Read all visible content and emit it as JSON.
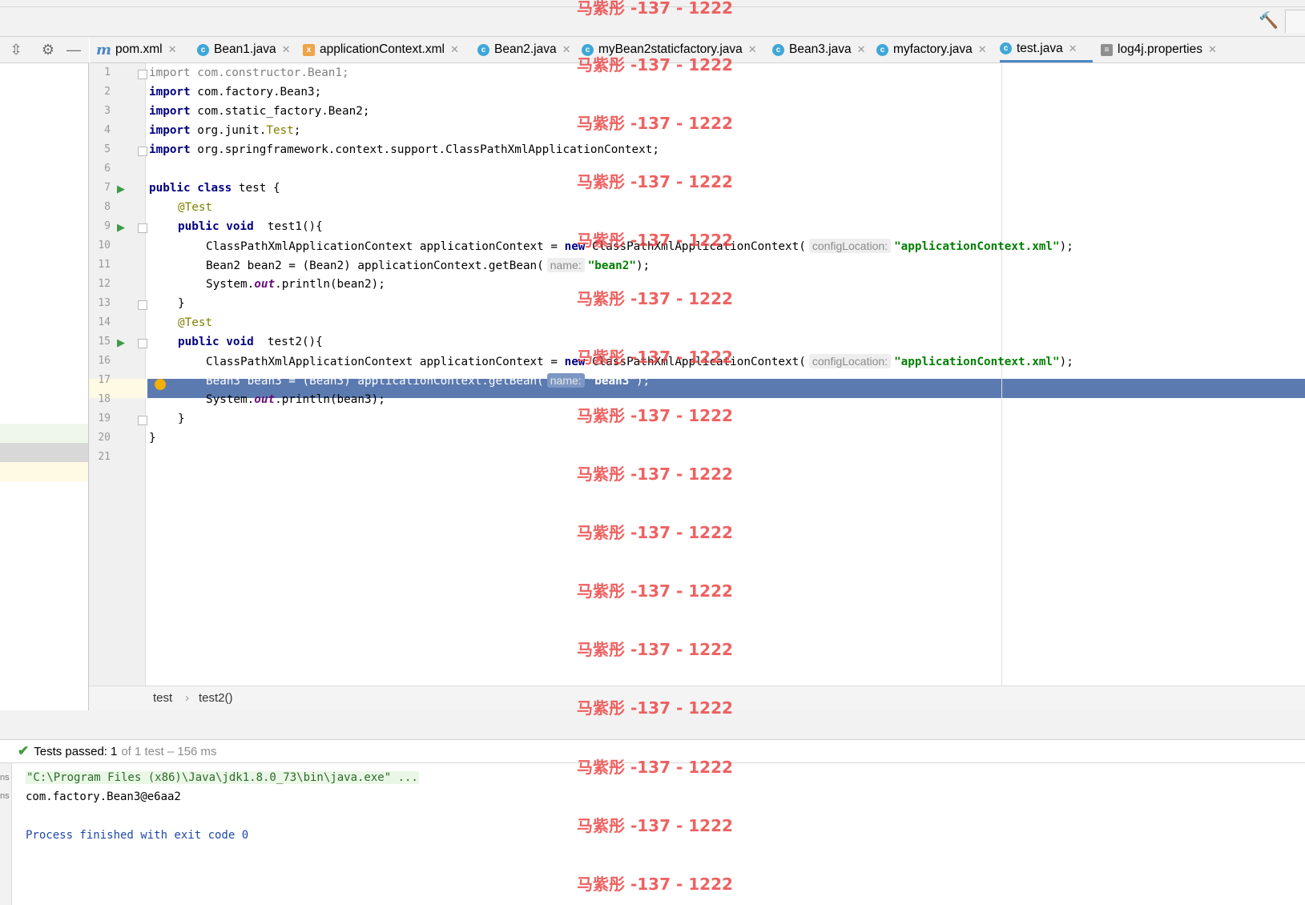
{
  "tabs": [
    {
      "label": "pom.xml",
      "icon": "maven-icon"
    },
    {
      "label": "Bean1.java",
      "icon": "class-icon"
    },
    {
      "label": "applicationContext.xml",
      "icon": "xml-icon"
    },
    {
      "label": "Bean2.java",
      "icon": "class-icon"
    },
    {
      "label": "myBean2staticfactory.java",
      "icon": "class-icon"
    },
    {
      "label": "Bean3.java",
      "icon": "class-icon"
    },
    {
      "label": "myfactory.java",
      "icon": "class-icon"
    },
    {
      "label": "test.java",
      "icon": "class-icon",
      "active": true
    },
    {
      "label": "log4j.properties",
      "icon": "properties-icon"
    }
  ],
  "line_numbers": [
    "1",
    "2",
    "3",
    "4",
    "5",
    "6",
    "7",
    "8",
    "9",
    "10",
    "11",
    "12",
    "13",
    "14",
    "15",
    "16",
    "17",
    "18",
    "19",
    "20",
    "21"
  ],
  "code": {
    "l1_kw": "import",
    "l1_rest": " com.constructor.Bean1;",
    "l2_kw": "import",
    "l2_rest": " com.factory.Bean3;",
    "l3_kw": "import",
    "l3_rest": " com.static_factory.Bean2;",
    "l4_kw": "import",
    "l4_a": " org.junit.",
    "l4_ann": "Test",
    "l4_b": ";",
    "l5_kw": "import",
    "l5_rest": " org.springframework.context.support.ClassPathXmlApplicationContext;",
    "l7_kw": "public class",
    "l7_rest": " test {",
    "l8_ann": "@Test",
    "l9_kw": "public void",
    "l9_rest": "  test1(){",
    "l10_a": "ClassPathXmlApplicationContext applicationContext = ",
    "l10_kw": "new",
    "l10_b": " ClassPathXmlApplicationContext(",
    "l10_hint": "configLocation:",
    "l10_str": "\"applicationContext.xml\"",
    "l10_c": ");",
    "l11_a": "Bean2 bean2 = (Bean2) applicationContext.getBean(",
    "l11_hint": "name:",
    "l11_str": "\"bean2\"",
    "l11_c": ");",
    "l12_a": "System.",
    "l12_fld": "out",
    "l12_b": ".println(bean2);",
    "l13": "}",
    "l14_ann": "@Test",
    "l15_kw": "public void",
    "l15_rest": "  test2(){",
    "l16_a": "ClassPathXmlApplicationContext applicationContext = ",
    "l16_kw": "new",
    "l16_b": " ClassPathXmlApplicationContext(",
    "l16_hint": "configLocation:",
    "l16_str": "\"applicationContext.xml\"",
    "l16_c": ");",
    "l17_a": "Bean3 bean3 = (Bean3) applicationContext.getBean(",
    "l17_hint": "name:",
    "l17_str": "\"bean3\"",
    "l17_c": ");",
    "l18_a": "System.",
    "l18_fld": "out",
    "l18_b": ".println(bean3);",
    "l19": "}",
    "l20": "}"
  },
  "breadcrumb": {
    "class": "test",
    "sep": "›",
    "method": "test2()"
  },
  "test_status": {
    "passed_label": "Tests passed:",
    "count": "1",
    "rest": "of 1 test – 156 ms"
  },
  "console": {
    "line1": "\"C:\\Program Files (x86)\\Java\\jdk1.8.0_73\\bin\\java.exe\" ...",
    "line2": "com.factory.Bean3@e6aa2",
    "line3": "Process finished with exit code 0"
  },
  "left_strip": {
    "row1": "ns",
    "row2": "ns"
  },
  "watermark": "马紫彤 -137 - 1222",
  "colors": {
    "keyword": "#000080",
    "string": "#008000",
    "annotation": "#808000",
    "current_line": "#5b7ab0",
    "tab_accent": "#4a88c7"
  }
}
